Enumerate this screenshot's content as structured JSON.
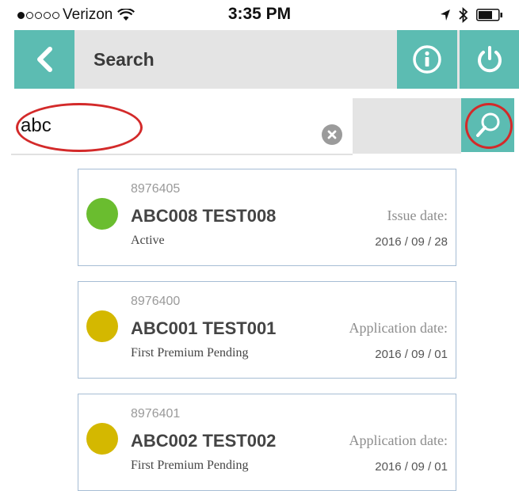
{
  "status_bar": {
    "carrier": "Verizon",
    "time": "3:35 PM",
    "signal_icon": "signal-dots-icon",
    "wifi_icon": "wifi-icon",
    "location_icon": "location-arrow-icon",
    "bluetooth_icon": "bluetooth-icon",
    "battery_icon": "battery-icon"
  },
  "nav": {
    "title": "Search",
    "back_icon": "chevron-left-icon",
    "info_icon": "info-icon",
    "power_icon": "power-icon"
  },
  "search": {
    "value": "abc",
    "clear_icon": "clear-icon",
    "search_icon": "search-icon"
  },
  "colors": {
    "accent": "#5cbcb2",
    "bar_bg": "#e4e4e4",
    "status_active": "#6abd2f",
    "status_pending": "#d4b800",
    "annotation": "#d32a2a",
    "card_border": "#a6bdd4"
  },
  "results": [
    {
      "id": "8976405",
      "name": "ABC008 TEST008",
      "status": "Active",
      "status_color": "#6abd2f",
      "date_label": "Issue date:",
      "date_value": "2016 / 09 / 28"
    },
    {
      "id": "8976400",
      "name": "ABC001 TEST001",
      "status": "First Premium Pending",
      "status_color": "#d4b800",
      "date_label": "Application date:",
      "date_value": "2016 / 09 / 01"
    },
    {
      "id": "8976401",
      "name": "ABC002 TEST002",
      "status": "First Premium Pending",
      "status_color": "#d4b800",
      "date_label": "Application date:",
      "date_value": "2016 / 09 / 01"
    }
  ]
}
